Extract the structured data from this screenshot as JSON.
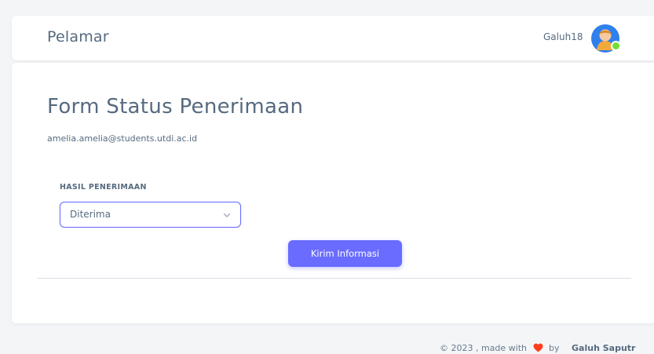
{
  "header": {
    "brand": "Pelamar",
    "username": "Galuh18"
  },
  "form": {
    "title": "Form Status Penerimaan",
    "email": "amelia.amelia@students.utdi.ac.id",
    "field_label": "HASIL PENERIMAAN",
    "select_value": "Diterima",
    "submit_label": "Kirim Informasi"
  },
  "footer": {
    "copyright": "© 2023 , made with",
    "by": "by",
    "author": "Galuh Saputr"
  },
  "colors": {
    "primary": "#696cff",
    "text": "#566a7f",
    "heart": "#ff3e1d",
    "online": "#71dd37"
  },
  "icons": [
    "avatar-icon",
    "chevron-down-icon",
    "heart-icon"
  ]
}
